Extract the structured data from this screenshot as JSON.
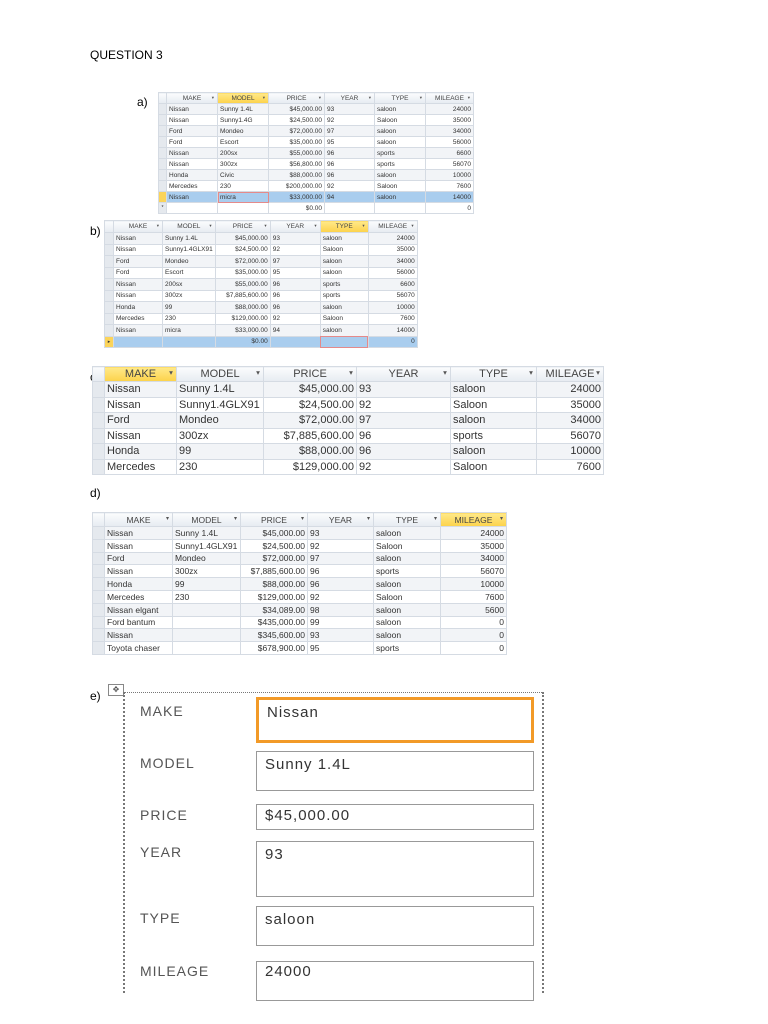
{
  "title": "QUESTION 3",
  "columns": [
    "MAKE",
    "MODEL",
    "PRICE",
    "YEAR",
    "TYPE",
    "MILEAGE"
  ],
  "colors": {
    "header_highlight": "#fcd24a",
    "selected_row": "#a9cdee",
    "active_field": "#f29a28"
  },
  "parts": {
    "a": {
      "label": "a)",
      "highlight_column": "MODEL",
      "rows": [
        [
          "Nissan",
          "Sunny 1.4L",
          "$45,000.00",
          "93",
          "saloon",
          "24000"
        ],
        [
          "Nissan",
          "Sunny1.4G",
          "$24,500.00",
          "92",
          "Saloon",
          "35000"
        ],
        [
          "Ford",
          "Mondeo",
          "$72,000.00",
          "97",
          "saloon",
          "34000"
        ],
        [
          "Ford",
          "Escort",
          "$35,000.00",
          "95",
          "saloon",
          "56000"
        ],
        [
          "Nissan",
          "200sx",
          "$55,000.00",
          "96",
          "sports",
          "6600"
        ],
        [
          "Nissan",
          "300zx",
          "$56,800.00",
          "96",
          "sports",
          "56070"
        ],
        [
          "Honda",
          "Civic",
          "$88,000.00",
          "96",
          "saloon",
          "10000"
        ],
        [
          "Mercedes",
          "230",
          "$200,000.00",
          "92",
          "Saloon",
          "7600"
        ],
        [
          "Nissan",
          "micra",
          "$33,000.00",
          "94",
          "saloon",
          "14000"
        ]
      ],
      "new_row": [
        "",
        "",
        "$0.00",
        "",
        "",
        "0"
      ]
    },
    "b": {
      "label": "b)",
      "highlight_column": "TYPE",
      "rows": [
        [
          "Nissan",
          "Sunny 1.4L",
          "$45,000.00",
          "93",
          "saloon",
          "24000"
        ],
        [
          "Nissan",
          "Sunny1.4GLX91",
          "$24,500.00",
          "92",
          "Saloon",
          "35000"
        ],
        [
          "Ford",
          "Mondeo",
          "$72,000.00",
          "97",
          "saloon",
          "34000"
        ],
        [
          "Ford",
          "Escort",
          "$35,000.00",
          "95",
          "saloon",
          "56000"
        ],
        [
          "Nissan",
          "200sx",
          "$55,000.00",
          "96",
          "sports",
          "6600"
        ],
        [
          "Nissan",
          "300zx",
          "$7,885,600.00",
          "96",
          "sports",
          "56070"
        ],
        [
          "Honda",
          "99",
          "$88,000.00",
          "96",
          "saloon",
          "10000"
        ],
        [
          "Mercedes",
          "230",
          "$129,000.00",
          "92",
          "Saloon",
          "7600"
        ],
        [
          "Nissan",
          "micra",
          "$33,000.00",
          "94",
          "saloon",
          "14000"
        ]
      ],
      "new_row": [
        "",
        "",
        "$0.00",
        "",
        "",
        "0"
      ]
    },
    "c": {
      "label": "c)",
      "highlight_column": "MAKE",
      "rows": [
        [
          "Nissan",
          "Sunny 1.4L",
          "$45,000.00",
          "93",
          "saloon",
          "24000"
        ],
        [
          "Nissan",
          "Sunny1.4GLX91",
          "$24,500.00",
          "92",
          "Saloon",
          "35000"
        ],
        [
          "Ford",
          "Mondeo",
          "$72,000.00",
          "97",
          "saloon",
          "34000"
        ],
        [
          "Nissan",
          "300zx",
          "$7,885,600.00",
          "96",
          "sports",
          "56070"
        ],
        [
          "Honda",
          "99",
          "$88,000.00",
          "96",
          "saloon",
          "10000"
        ],
        [
          "Mercedes",
          "230",
          "$129,000.00",
          "92",
          "Saloon",
          "7600"
        ]
      ]
    },
    "d": {
      "label": "d)",
      "highlight_column": "MILEAGE",
      "rows": [
        [
          "Nissan",
          "Sunny 1.4L",
          "$45,000.00",
          "93",
          "saloon",
          "24000"
        ],
        [
          "Nissan",
          "Sunny1.4GLX91",
          "$24,500.00",
          "92",
          "Saloon",
          "35000"
        ],
        [
          "Ford",
          "Mondeo",
          "$72,000.00",
          "97",
          "saloon",
          "34000"
        ],
        [
          "Nissan",
          "300zx",
          "$7,885,600.00",
          "96",
          "sports",
          "56070"
        ],
        [
          "Honda",
          "99",
          "$88,000.00",
          "96",
          "saloon",
          "10000"
        ],
        [
          "Mercedes",
          "230",
          "$129,000.00",
          "92",
          "Saloon",
          "7600"
        ],
        [
          "Nissan elgant",
          "",
          "$34,089.00",
          "98",
          "saloon",
          "5600"
        ],
        [
          "Ford bantum",
          "",
          "$435,000.00",
          "99",
          "saloon",
          "0"
        ],
        [
          "Nissan",
          "",
          "$345,600.00",
          "93",
          "saloon",
          "0"
        ],
        [
          "Toyota chaser",
          "",
          "$678,900.00",
          "95",
          "sports",
          "0"
        ]
      ]
    },
    "e": {
      "label": "e)",
      "fields": [
        {
          "label": "MAKE",
          "value": "Nissan"
        },
        {
          "label": "MODEL",
          "value": "Sunny 1.4L"
        },
        {
          "label": "PRICE",
          "value": "$45,000.00"
        },
        {
          "label": "YEAR",
          "value": "93"
        },
        {
          "label": "TYPE",
          "value": "saloon"
        },
        {
          "label": "MILEAGE",
          "value": "24000"
        }
      ]
    }
  }
}
